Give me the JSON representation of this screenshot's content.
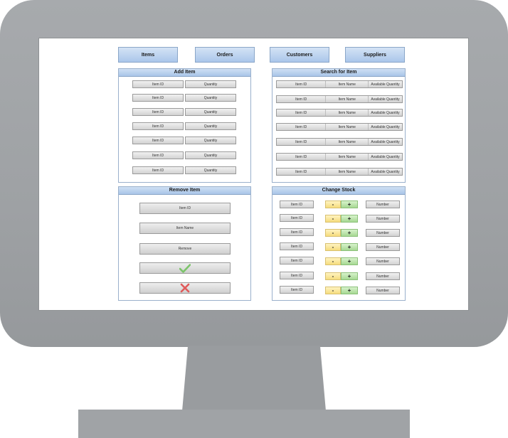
{
  "nav": {
    "tabs": [
      {
        "label": "Items"
      },
      {
        "label": "Orders"
      },
      {
        "label": "Customers"
      },
      {
        "label": "Suppliers"
      }
    ]
  },
  "add_item": {
    "title": "Add Item",
    "rows": [
      {
        "id": "Item ID",
        "quantity": "Quantity"
      },
      {
        "id": "Item ID",
        "quantity": "Quantity"
      },
      {
        "id": "Item ID",
        "quantity": "Quantity"
      },
      {
        "id": "Item ID",
        "quantity": "Quantity"
      },
      {
        "id": "Item ID",
        "quantity": "Quantity"
      },
      {
        "id": "Item ID",
        "quantity": "Quantity"
      },
      {
        "id": "Item ID",
        "quantity": "Quantity"
      }
    ]
  },
  "search": {
    "title": "Search for Item",
    "rows": [
      {
        "id": "Item ID",
        "name": "Item Name",
        "qty": "Available Quantity"
      },
      {
        "id": "Item ID",
        "name": "Item Name",
        "qty": "Available Quantity"
      },
      {
        "id": "Item ID",
        "name": "Item Name",
        "qty": "Available Quantity"
      },
      {
        "id": "Item ID",
        "name": "Item Name",
        "qty": "Available Quantity"
      },
      {
        "id": "Item ID",
        "name": "Item Name",
        "qty": "Available Quantity"
      },
      {
        "id": "Item ID",
        "name": "Item Name",
        "qty": "Available Quantity"
      },
      {
        "id": "Item ID",
        "name": "Item Name",
        "qty": "Available Quantity"
      }
    ]
  },
  "remove_item": {
    "title": "Remove Item",
    "id_label": "Item ID",
    "name_label": "Item Name",
    "remove_label": "Remove",
    "confirm_icon": "checkmark-icon",
    "cancel_icon": "x-icon",
    "confirm_color": "#7cc46a",
    "cancel_color": "#e05a5a"
  },
  "change_stock": {
    "title": "Change Stock",
    "rows": [
      {
        "id": "Item ID",
        "minus": "-",
        "plus": "+",
        "number": "Number"
      },
      {
        "id": "Item ID",
        "minus": "-",
        "plus": "+",
        "number": "Number"
      },
      {
        "id": "Item ID",
        "minus": "-",
        "plus": "+",
        "number": "Number"
      },
      {
        "id": "Item ID",
        "minus": "-",
        "plus": "+",
        "number": "Number"
      },
      {
        "id": "Item ID",
        "minus": "-",
        "plus": "+",
        "number": "Number"
      },
      {
        "id": "Item ID",
        "minus": "-",
        "plus": "+",
        "number": "Number"
      },
      {
        "id": "Item ID",
        "minus": "-",
        "plus": "+",
        "number": "Number"
      }
    ]
  }
}
